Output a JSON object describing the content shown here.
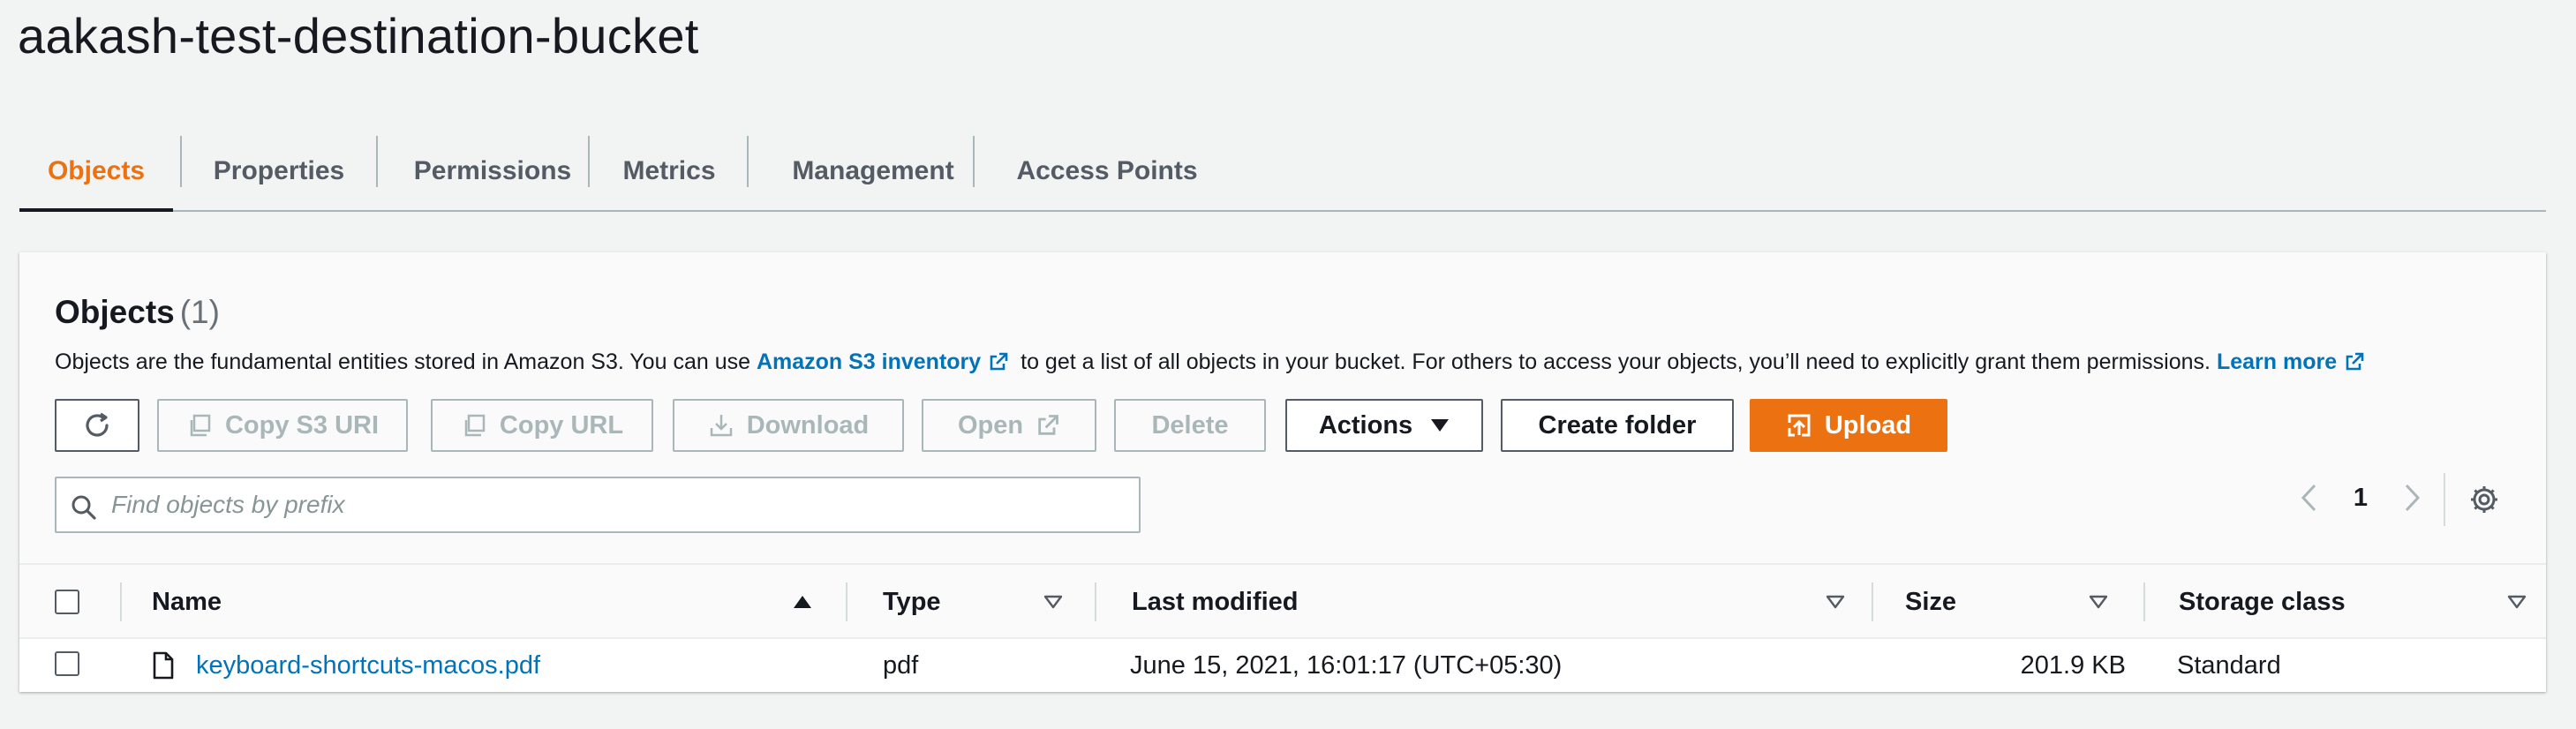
{
  "page": {
    "title": "aakash-test-destination-bucket"
  },
  "tabs": [
    {
      "label": "Objects",
      "active": true
    },
    {
      "label": "Properties"
    },
    {
      "label": "Permissions"
    },
    {
      "label": "Metrics"
    },
    {
      "label": "Management"
    },
    {
      "label": "Access Points"
    }
  ],
  "objects_panel": {
    "heading": "Objects",
    "count": "(1)",
    "description": {
      "part1": "Objects are the fundamental entities stored in Amazon S3. You can use ",
      "link1": "Amazon S3 inventory",
      "part2": " to get a list of all objects in your bucket. For others to access your objects, you’ll need to explicitly grant them permissions. ",
      "link2": "Learn more"
    },
    "toolbar": {
      "refresh_icon": "refresh-icon",
      "copy_s3_uri": "Copy S3 URI",
      "copy_url": "Copy URL",
      "download": "Download",
      "open": "Open",
      "delete": "Delete",
      "actions": "Actions",
      "create_folder": "Create folder",
      "upload": "Upload"
    },
    "search": {
      "placeholder": "Find objects by prefix",
      "value": ""
    },
    "pagination": {
      "current_page": "1"
    },
    "table": {
      "columns": [
        "Name",
        "Type",
        "Last modified",
        "Size",
        "Storage class"
      ],
      "rows": [
        {
          "name": "keyboard-shortcuts-macos.pdf",
          "type": "pdf",
          "last_modified": "June 15, 2021, 16:01:17 (UTC+05:30)",
          "size": "201.9 KB",
          "storage_class": "Standard"
        }
      ]
    }
  },
  "colors": {
    "accent": "#ec7211",
    "link": "#0073bb",
    "text": "#16191f",
    "disabled": "#aab7b8",
    "background": "#f2f3f3"
  }
}
